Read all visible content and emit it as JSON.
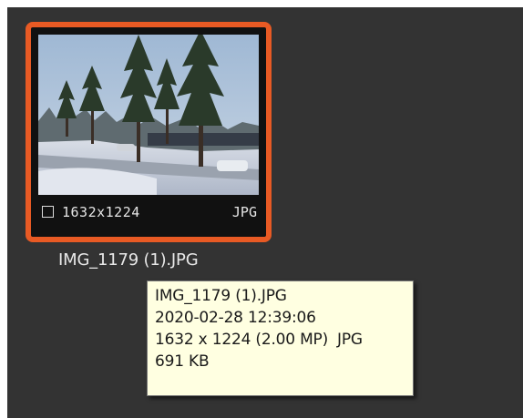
{
  "thumbnail": {
    "selected": true,
    "accent_color": "#e85a24",
    "dimensions": "1632x1224",
    "format": "JPG",
    "filename": "IMG_1179 (1).JPG",
    "checkbox_checked": false
  },
  "tooltip": {
    "filename": "IMG_1179 (1).JPG",
    "datetime": "2020-02-28 12:39:06",
    "resolution": "1632 x 1224 (2.00 MP)",
    "format": "JPG",
    "filesize": "691 KB"
  },
  "colors": {
    "panel_background": "#333333",
    "tooltip_background": "#ffffe1"
  }
}
